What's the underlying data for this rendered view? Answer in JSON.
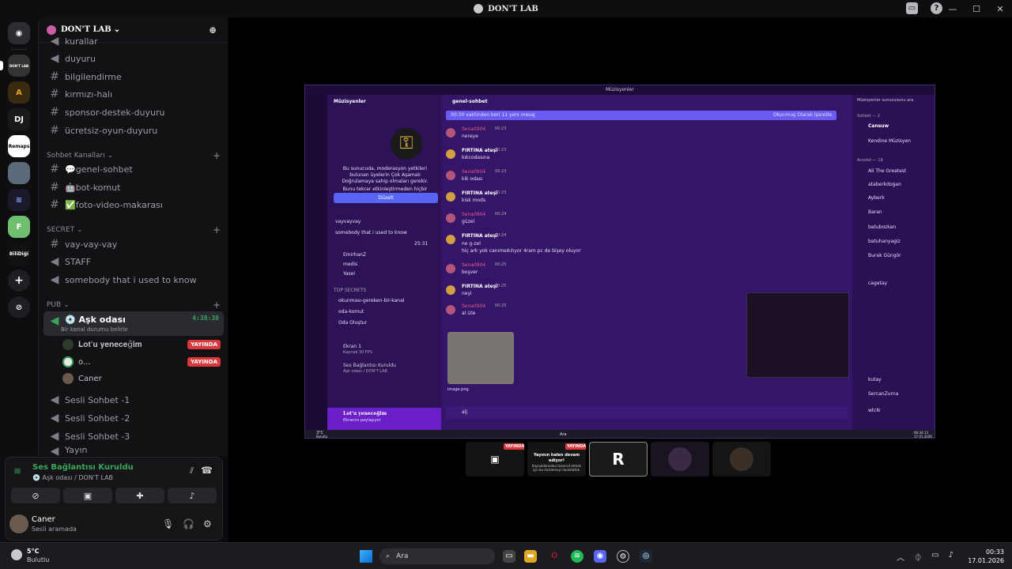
{
  "window": {
    "title": "DON'T LAB"
  },
  "server": {
    "name": "DON'T LAB"
  },
  "guilds": [
    "DON'T LAB",
    "DJ",
    "Remaps",
    "BiliDiği"
  ],
  "channels": {
    "top_partial": "kurallar",
    "announce": [
      "duyuru",
      "bilgilendirme",
      "kırmızı-halı",
      "sponsor-destek-duyuru",
      "ücretsiz-oyun-duyuru"
    ],
    "cat_chat": "Sohbet Kanalları",
    "chat": [
      "💬genel-sohbet",
      "🤖bot-komut",
      "✅foto-video-makarası"
    ],
    "cat_secret": "SECRET",
    "secret": [
      "vay-vay-vay",
      "STAFF",
      "somebody that i used to know"
    ],
    "cat_pub": "PUB",
    "active_voice": "💿 Aşk odası",
    "active_timer": "4:38:38",
    "active_status": "Bir kanal durumu belirle",
    "voice_users": [
      {
        "name": "𝐋𝐨𝐭'𝐮 𝐲𝐞𝐧𝐞𝐜𝐞ğ𝐢𝐦",
        "live": "YAYINDA"
      },
      {
        "name": "o...",
        "live": "YAYINDA"
      },
      {
        "name": "Caner",
        "live": ""
      }
    ],
    "voice_others": [
      "Sesli Sohbet -1",
      "Sesli Sohbet -2",
      "Sesli Sohbet -3",
      "Yayın"
    ]
  },
  "voice_panel": {
    "status": "Ses Bağlantısı Kuruldu",
    "location": "💿 Aşk odası / DON'T LAB"
  },
  "user": {
    "name": "Caner",
    "status": "Sesli aramada"
  },
  "stream": {
    "server": "Müzisyenler",
    "channel": "genel-sohbet",
    "banner": "00:30 vaktinden beri 11 yeni mesaj",
    "banner_action": "Okunmuş Olarak İşaretle",
    "search_placeholder": "Müzisyenler sunucusunu ara",
    "mod_notice": "Bu sunucuda, moderasyon yetkileri bulunan üyelerin Çok Aşamalı Doğrulamaya sahip olmaları gerekir.",
    "mod_notice2": "Bunu tekrar etkinleştirmeden hiçbir moderasyon işlemi yapamazsın.",
    "fix_button": "Düzelt",
    "messages": [
      {
        "author": "Sena0904",
        "time": "00:23",
        "text": "nereye"
      },
      {
        "author": "FIRTINA ateşi",
        "time": "00:23",
        "text": "kıkcodasına"
      },
      {
        "author": "Sena0904",
        "time": "00:23",
        "text": "kik odası"
      },
      {
        "author": "FIRTINA ateşi",
        "time": "00:23",
        "text": "kisk mods"
      },
      {
        "author": "Sena0904",
        "time": "00:24",
        "text": "güzel"
      },
      {
        "author": "FIRTINA ateşi",
        "time": "00:24",
        "text": "ne g-zel\nhiç ark yok canımsıkılıyor 4ram pc de bişey oluyor"
      },
      {
        "author": "Sena0904",
        "time": "00:25",
        "text": "boşver"
      },
      {
        "author": "FIRTINA ateşi",
        "time": "00:25",
        "text": "neyi"
      },
      {
        "author": "Sena0904",
        "time": "00:25",
        "text": "al izle"
      }
    ],
    "image_name": "image.png",
    "compose": "alj",
    "side_channels": [
      "vayvayvay",
      "somebody that i used to know",
      "TOP SECRETS",
      "okunması-gereken-bir-kanal",
      "oda-komut",
      "Oda Oluştur"
    ],
    "side_users": [
      "EmirhanZ",
      "medis",
      "Yasel"
    ],
    "side_timer": "25:31",
    "screen_label": "Ekran 1",
    "screen_sub": "Kaynak 30 FPS",
    "voice_status": "Ses Bağlantısı Kuruldu",
    "voice_loc": "Aşk odası / DON'T LAB",
    "streamer": "𝐋𝐨𝐭'𝐮 𝐲𝐞𝐧𝐞𝐜𝐞ğ𝐢𝐦",
    "streamer_status": "Ekranını paylaşıyor",
    "members_cat1": "Sohbet — 2",
    "members": [
      "Cansuw",
      "Kendine Müzisyen",
      "Ali The Greatest",
      "ataberkdogan",
      "Ayberk",
      "Baran",
      "batubozkan",
      "batuhanyagiz",
      "Burak Güngör",
      "cagatay",
      "kutay",
      "SercanZurna",
      "wtcN"
    ],
    "members_cat2": "Acsolot — 19",
    "weather_temp": "3°C",
    "weather_desc": "Bulutlu",
    "clock": "00:34:13",
    "date": "17.01.2026",
    "search": "Ara"
  },
  "thumbnails": [
    {
      "live": "YAYINDA",
      "text": ""
    },
    {
      "live": "YAYINDA",
      "text": "Yayının halen devam ediyor!",
      "sub": "Kaynaklarından tasarruf etmek için bu önizlemeyi duraklattık."
    },
    {
      "live": "",
      "text": "R"
    },
    {
      "live": "",
      "text": ""
    },
    {
      "live": "",
      "text": ""
    }
  ],
  "taskbar": {
    "weather_temp": "5°C",
    "weather_desc": "Bulutlu",
    "search": "Ara",
    "time": "00:33",
    "date": "17.01.2026"
  }
}
